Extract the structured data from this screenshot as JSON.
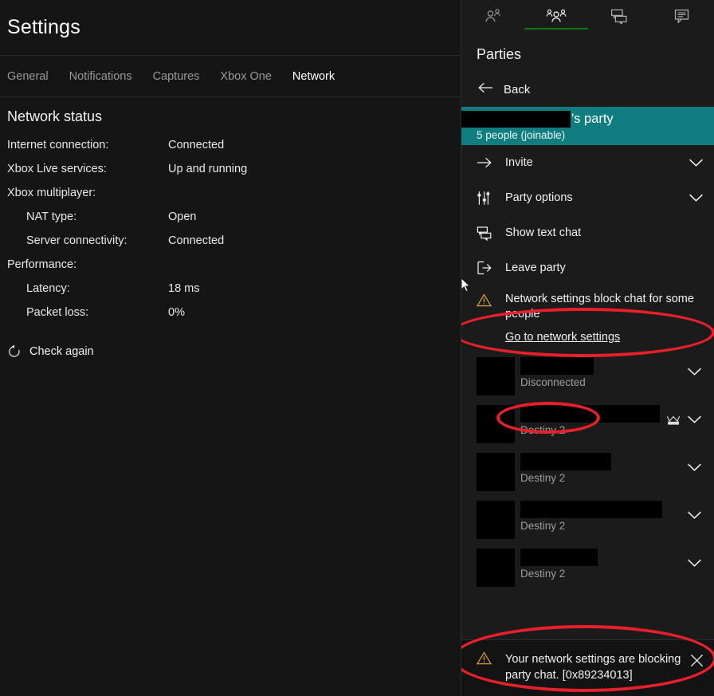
{
  "settings": {
    "title": "Settings",
    "tabs": [
      {
        "label": "General",
        "active": false
      },
      {
        "label": "Notifications",
        "active": false
      },
      {
        "label": "Captures",
        "active": false
      },
      {
        "label": "Xbox One",
        "active": false
      },
      {
        "label": "Network",
        "active": true
      }
    ],
    "section_heading": "Network status",
    "rows": [
      {
        "label": "Internet connection:",
        "value": "Connected",
        "indent": false
      },
      {
        "label": "Xbox Live services:",
        "value": "Up and running",
        "indent": false
      },
      {
        "label": "Xbox multiplayer:",
        "value": "",
        "indent": false
      },
      {
        "label": "NAT type:",
        "value": "Open",
        "indent": true
      },
      {
        "label": "Server connectivity:",
        "value": "Connected",
        "indent": true
      },
      {
        "label": "Performance:",
        "value": "",
        "indent": false
      },
      {
        "label": "Latency:",
        "value": "18 ms",
        "indent": true
      },
      {
        "label": "Packet loss:",
        "value": "0%",
        "indent": true
      }
    ],
    "check_again_label": "Check again",
    "check_again_icon": "refresh-icon"
  },
  "game_bar": {
    "tabs": [
      {
        "icon": "friends-icon",
        "name": "tab-friends",
        "active": false
      },
      {
        "icon": "parties-group-icon",
        "name": "tab-parties",
        "active": true
      },
      {
        "icon": "text-chat-icon",
        "name": "tab-text-chat",
        "active": false
      },
      {
        "icon": "messages-icon",
        "name": "tab-messages",
        "active": false
      }
    ],
    "heading": "Parties",
    "back_label": "Back",
    "back_icon": "arrow-left-icon",
    "party": {
      "name_redacted": true,
      "title_suffix": "'s party",
      "subtitle": "5 people (joinable)",
      "banner_color": "#127d80"
    },
    "menu": [
      {
        "label": "Invite",
        "icon": "arrow-right-icon",
        "chevron": true
      },
      {
        "label": "Party options",
        "icon": "sliders-icon",
        "chevron": true
      },
      {
        "label": "Show text chat",
        "icon": "text-chat-icon",
        "chevron": false
      },
      {
        "label": "Leave party",
        "icon": "leave-icon",
        "chevron": false
      }
    ],
    "inline_warning": {
      "icon": "warning-triangle-icon",
      "text": "Network settings block chat for some people",
      "link_label": "Go to network settings"
    },
    "members": [
      {
        "name_redacted": true,
        "redact_width": 92,
        "status": "Disconnected",
        "is_leader": false,
        "chevron": true
      },
      {
        "name_redacted": true,
        "redact_width": 175,
        "status": "Destiny 2",
        "is_leader": true,
        "chevron": true
      },
      {
        "name_redacted": true,
        "redact_width": 114,
        "status": "Destiny 2",
        "is_leader": false,
        "chevron": true
      },
      {
        "name_redacted": true,
        "redact_width": 178,
        "status": "Destiny 2",
        "is_leader": false,
        "chevron": true
      },
      {
        "name_redacted": true,
        "redact_width": 97,
        "status": "Destiny 2",
        "is_leader": false,
        "chevron": true
      }
    ],
    "toast": {
      "icon": "warning-triangle-icon",
      "text": "Your network settings are blocking party chat. [0x89234013]",
      "close_icon": "close-icon"
    }
  },
  "annotations": {
    "accent_color": "#e8202a",
    "warning_color": "#d8a03a",
    "xbox_green": "#107c10"
  }
}
